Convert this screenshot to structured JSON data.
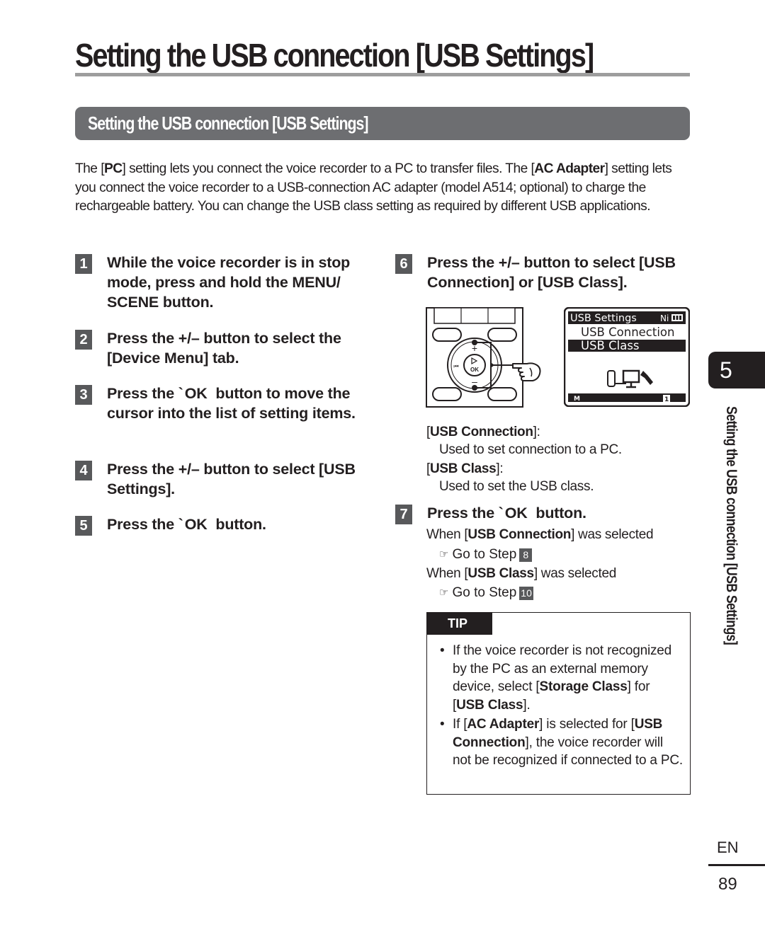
{
  "page": {
    "title": "Setting the USB connection [USB Settings]",
    "section_heading": "Setting the USB connection [USB Settings]",
    "intro": {
      "p1": "The [",
      "b1": "PC",
      "p2": "] setting lets you connect the voice recorder to a PC to transfer files. The [",
      "b2": "AC Adapter",
      "p3": "] setting lets you connect the voice recorder to a USB-connection AC adapter (model A514; optional) to charge the rechargeable battery. You can change the USB class setting as required by different USB applications."
    }
  },
  "steps": [
    {
      "num": "1",
      "a": "While the voice recorder is in stop mode, press and hold the ",
      "b": "MENU/ SCENE",
      "c": " button."
    },
    {
      "num": "2",
      "a": "Press the +/– button to select the [",
      "b": "Device Menu",
      "c": "] tab."
    },
    {
      "num": "3",
      "a": "Press the `",
      "b": "OK",
      "c": " button to move the cursor into the list of setting items."
    },
    {
      "num": "4",
      "a": "Press the +/– button to select [",
      "b": "USB Settings",
      "c": "]."
    },
    {
      "num": "5",
      "a": "Press the `",
      "b": "OK",
      "c": " button."
    },
    {
      "num": "6",
      "a": "Press the +/– button to select [",
      "b": "USB Connection",
      "c": "] or [",
      "d": "USB Class",
      "e": "]."
    },
    {
      "num": "7",
      "a": "Press the `",
      "b": "OK",
      "c": " button."
    }
  ],
  "device_illustration": {
    "plus_label": "+",
    "minus_label": "–",
    "ok_label": "OK"
  },
  "screen": {
    "header": "USB Settings",
    "battery_label": "Ni",
    "items": [
      "USB Connection",
      "USB Class"
    ],
    "selected_index": 1,
    "footer_left": "M",
    "footer_right": "1"
  },
  "notes": {
    "usb_connection_label": "USB Connection",
    "usb_connection_desc": "Used to set connection to a PC.",
    "usb_class_label": "USB Class",
    "usb_class_desc": "Used to set the USB class."
  },
  "step7_branches": [
    {
      "prefix": "When [",
      "bold": "USB Connection",
      "suffix": "] was selected",
      "goto": "Go to Step",
      "target": "8"
    },
    {
      "prefix": "When [",
      "bold": "USB Class",
      "suffix": "] was selected",
      "goto": "Go to Step",
      "target": "10"
    }
  ],
  "tip": {
    "label": "TIP",
    "items": [
      {
        "a": "If the voice recorder is not recognized by the PC as an external memory device, select [",
        "b": "Storage Class",
        "c": "] for [",
        "d": "USB Class",
        "e": "]."
      },
      {
        "a": "If [",
        "b": "AC Adapter",
        "c": "] is selected for [",
        "d": "USB Connection",
        "e": "], the voice recorder will not be recognized if connected to a PC."
      }
    ]
  },
  "sidebar": {
    "chapter": "5",
    "label": "Setting the USB connection [USB Settings]",
    "language": "EN",
    "page_number": "89"
  }
}
